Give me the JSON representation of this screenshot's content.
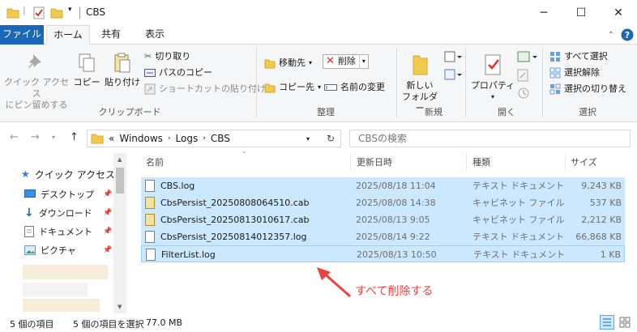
{
  "window": {
    "title": "CBS",
    "minimize": "─",
    "maximize": "☐",
    "close": "✕"
  },
  "tabs": {
    "file": "ファイル",
    "home": "ホーム",
    "share": "共有",
    "view": "表示"
  },
  "ribbon": {
    "clipboard": {
      "pin_line1": "クイック アクセス",
      "pin_line2": "にピン留めする",
      "copy": "コピー",
      "paste": "貼り付け",
      "cut": "切り取り",
      "copy_path": "パスのコピー",
      "paste_shortcut": "ショートカットの貼り付け",
      "label": "クリップボード"
    },
    "organize": {
      "move_to": "移動先",
      "copy_to": "コピー先",
      "delete": "削除",
      "rename": "名前の変更",
      "label": "整理"
    },
    "new": {
      "new_folder_line1": "新しい",
      "new_folder_line2": "フォルダー",
      "label": "新規"
    },
    "open": {
      "properties": "プロパティ",
      "label": "開く"
    },
    "select": {
      "select_all": "すべて選択",
      "select_none": "選択解除",
      "invert": "選択の切り替え",
      "label": "選択"
    }
  },
  "address": {
    "prefix": "«",
    "crumbs": [
      "Windows",
      "Logs",
      "CBS"
    ],
    "search_placeholder": "CBSの検索"
  },
  "nav": {
    "quick_access": "クイック アクセス",
    "items": [
      "デスクトップ",
      "ダウンロード",
      "ドキュメント",
      "ピクチャ"
    ]
  },
  "columns": {
    "name": "名前",
    "modified": "更新日時",
    "type": "種類",
    "size": "サイズ"
  },
  "files": [
    {
      "name": "CBS.log",
      "modified": "2025/08/18 11:04",
      "type": "テキスト ドキュメント",
      "size": "9,243 KB",
      "kind": "log"
    },
    {
      "name": "CbsPersist_20250808064510.cab",
      "modified": "2025/08/08 14:38",
      "type": "キャビネット ファイル",
      "size": "537 KB",
      "kind": "cab"
    },
    {
      "name": "CbsPersist_20250813010617.cab",
      "modified": "2025/08/13 9:05",
      "type": "キャビネット ファイル",
      "size": "2,212 KB",
      "kind": "cab"
    },
    {
      "name": "CbsPersist_20250814012357.log",
      "modified": "2025/08/14 9:22",
      "type": "テキスト ドキュメント",
      "size": "66,868 KB",
      "kind": "log"
    },
    {
      "name": "FilterList.log",
      "modified": "2025/08/13 10:50",
      "type": "テキスト ドキュメント",
      "size": "1 KB",
      "kind": "log"
    }
  ],
  "annotation": "すべて削除する",
  "status": {
    "count": "5 個の項目",
    "selected": "5 個の項目を選択",
    "size": "77.0 MB"
  },
  "colors": {
    "accent": "#1a67b6",
    "selection": "#cce8ff",
    "annotation": "#e8443a",
    "folder": "#f2c94c"
  }
}
